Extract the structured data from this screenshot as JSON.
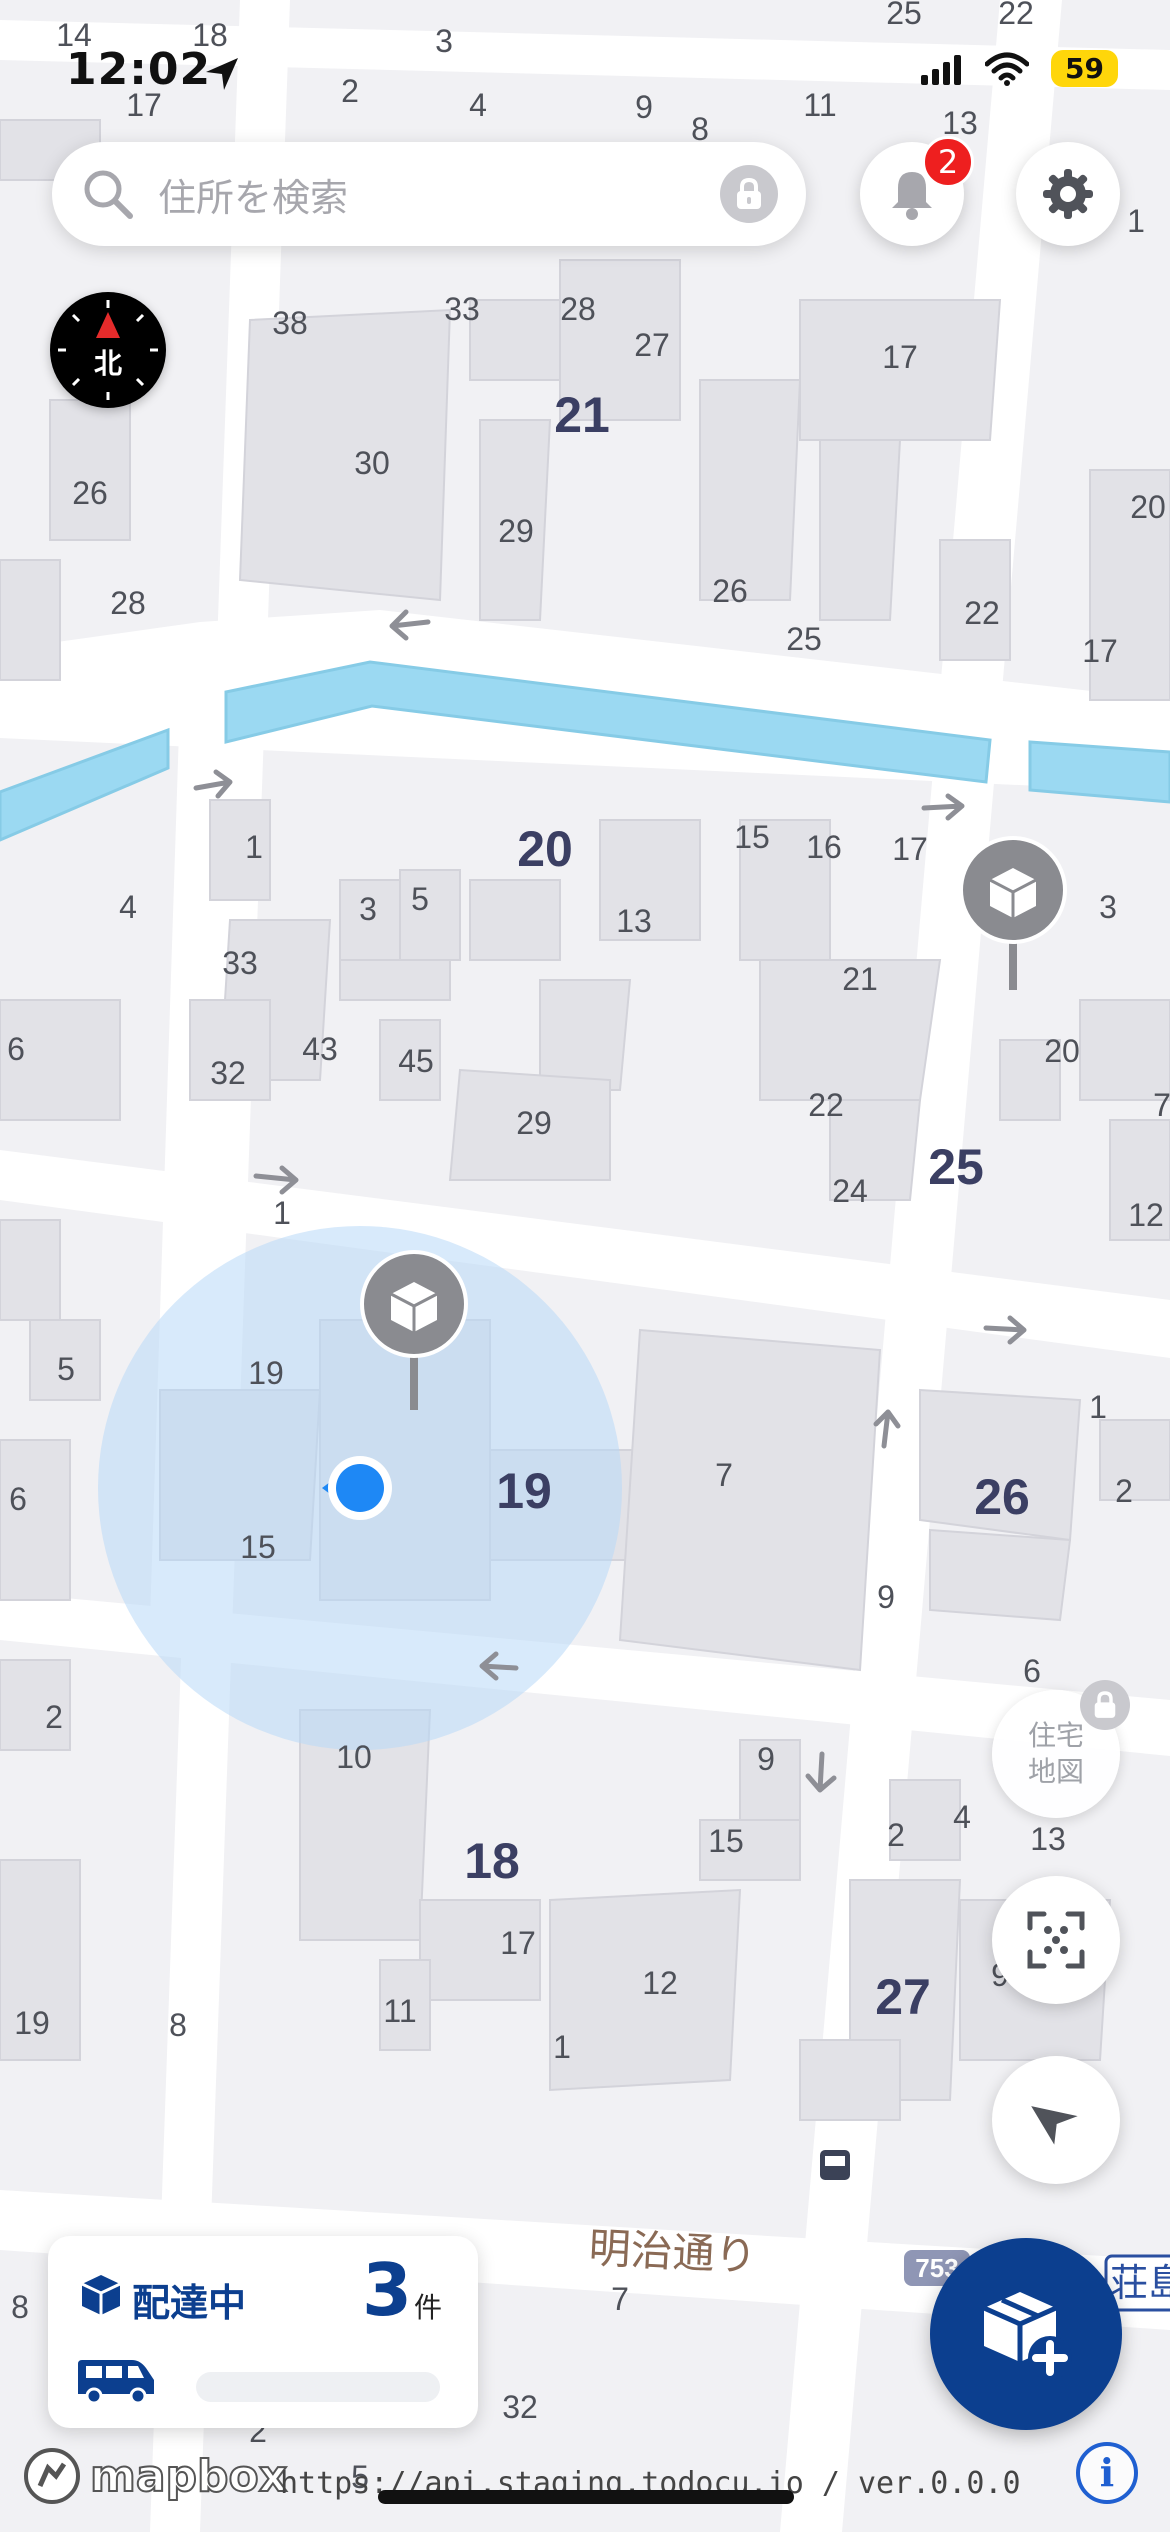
{
  "status_bar": {
    "time": "12:02",
    "battery": "59"
  },
  "search": {
    "placeholder": "住所を検索"
  },
  "notifications": {
    "badge_count": "2"
  },
  "compass": {
    "label": "北"
  },
  "jutaku_button": {
    "label_line1": "住宅",
    "label_line2": "地図"
  },
  "delivery_card": {
    "label": "配達中",
    "count": "3",
    "unit": "件",
    "progress": 0
  },
  "footer": {
    "mapbox": "mapbox",
    "api_text": "https://api.staging.todocu.io / ver.0.0.0",
    "info": "i"
  },
  "map": {
    "road_name": "明治通り",
    "route_shield": "753",
    "edge_place_label": "荘島",
    "block_numbers": [
      {
        "text": "21"
      },
      {
        "text": "20"
      },
      {
        "text": "25"
      },
      {
        "text": "19"
      },
      {
        "text": "26"
      },
      {
        "text": "18"
      },
      {
        "text": "27"
      }
    ],
    "house_numbers": [
      {
        "text": "14"
      },
      {
        "text": "18"
      },
      {
        "text": "17"
      },
      {
        "text": "3"
      },
      {
        "text": "2"
      },
      {
        "text": "4"
      },
      {
        "text": "9"
      },
      {
        "text": "8"
      },
      {
        "text": "11"
      },
      {
        "text": "13"
      },
      {
        "text": "25"
      },
      {
        "text": "22"
      },
      {
        "text": "1"
      },
      {
        "text": "38"
      },
      {
        "text": "33"
      },
      {
        "text": "28"
      },
      {
        "text": "27"
      },
      {
        "text": "17"
      },
      {
        "text": "26"
      },
      {
        "text": "30"
      },
      {
        "text": "29"
      },
      {
        "text": "20"
      },
      {
        "text": "28"
      },
      {
        "text": "26"
      },
      {
        "text": "25"
      },
      {
        "text": "22"
      },
      {
        "text": "17"
      },
      {
        "text": "1"
      },
      {
        "text": "4"
      },
      {
        "text": "15"
      },
      {
        "text": "16"
      },
      {
        "text": "17"
      },
      {
        "text": "3"
      },
      {
        "text": "3"
      },
      {
        "text": "5"
      },
      {
        "text": "13"
      },
      {
        "text": "33"
      },
      {
        "text": "21"
      },
      {
        "text": "6"
      },
      {
        "text": "43"
      },
      {
        "text": "45"
      },
      {
        "text": "32"
      },
      {
        "text": "20"
      },
      {
        "text": "7"
      },
      {
        "text": "29"
      },
      {
        "text": "22"
      },
      {
        "text": "24"
      },
      {
        "text": "1"
      },
      {
        "text": "12"
      },
      {
        "text": "5"
      },
      {
        "text": "19"
      },
      {
        "text": "1"
      },
      {
        "text": "6"
      },
      {
        "text": "15"
      },
      {
        "text": "7"
      },
      {
        "text": "2"
      },
      {
        "text": "9"
      },
      {
        "text": "6"
      },
      {
        "text": "2"
      },
      {
        "text": "10"
      },
      {
        "text": "9"
      },
      {
        "text": "15"
      },
      {
        "text": "2"
      },
      {
        "text": "4"
      },
      {
        "text": "13"
      },
      {
        "text": "17"
      },
      {
        "text": "11"
      },
      {
        "text": "12"
      },
      {
        "text": "1"
      },
      {
        "text": "9"
      },
      {
        "text": "19"
      },
      {
        "text": "8"
      },
      {
        "text": "8"
      },
      {
        "text": "7"
      },
      {
        "text": "32"
      },
      {
        "text": "2"
      },
      {
        "text": "5"
      }
    ]
  }
}
